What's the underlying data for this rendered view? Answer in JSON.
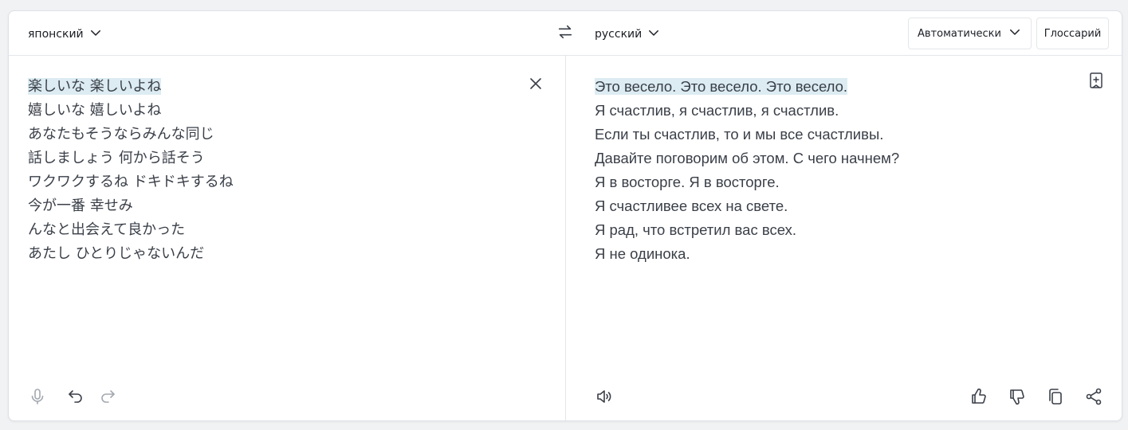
{
  "source": {
    "language": "японский",
    "lines": [
      "楽しいな 楽しいよね",
      "嬉しいな 嬉しいよね",
      "あなたもそうならみんな同じ",
      "話しましょう 何から話そう",
      "ワクワクするね ドキドキするね",
      "今が一番 幸せみ",
      "んなと出会えて良かった",
      "あたし ひとりじゃないんだ"
    ]
  },
  "target": {
    "language": "русский",
    "lines": [
      "Это весело. Это весело. Это весело.",
      "Я счастлив, я счастлив, я счастлив.",
      "Если ты счастлив, то и мы все счастливы.",
      "Давайте поговорим об этом. С чего начнем?",
      "Я в восторге. Я в восторге.",
      "Я счастливее всех на свете.",
      "Я рад, что встретил вас всех.",
      "Я не одинока."
    ]
  },
  "toolbar": {
    "formality_label": "Автоматически",
    "glossary_label": "Глоссарий"
  },
  "icons": {
    "source_lang_dropdown": "chevron-down-icon",
    "swap": "swap-arrows-icon",
    "clear": "close-icon",
    "mic": "microphone-icon",
    "undo": "undo-icon",
    "redo": "redo-icon",
    "speaker": "speaker-icon",
    "bookmark": "bookmark-add-icon",
    "like": "thumbs-up-icon",
    "dislike": "thumbs-down-icon",
    "copy": "copy-icon",
    "share": "share-icon"
  },
  "colors": {
    "highlight": "#dcecf2",
    "text": "#3a3f48",
    "icon": "#3a3f48",
    "icon_disabled": "#a3a8b0"
  }
}
